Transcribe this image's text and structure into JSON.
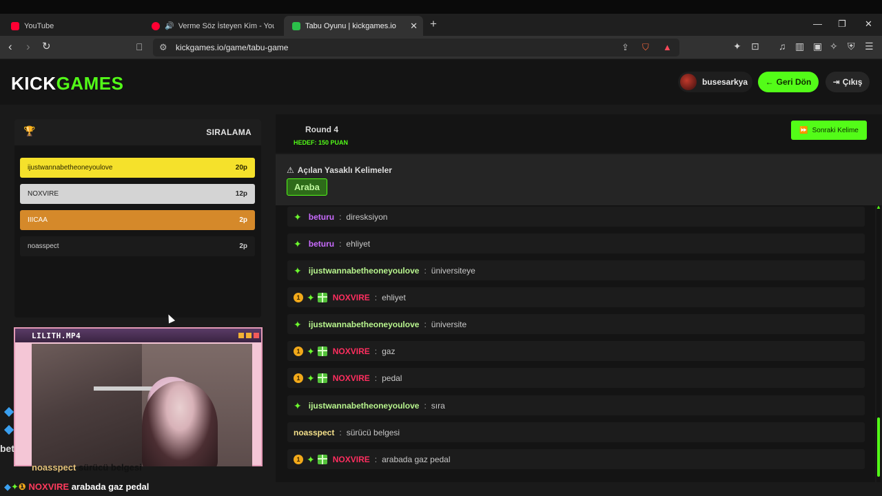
{
  "browser": {
    "tabs": [
      {
        "label": "YouTube",
        "icon": "youtube-icon"
      },
      {
        "label": "Verme Söz İsteyen Kim - YouTube",
        "icon": "youtube-icon"
      },
      {
        "label": "Tabu Oyunu | kickgames.io",
        "icon": "kick-icon"
      }
    ],
    "url": "kickgames.io/game/tabu-game"
  },
  "header": {
    "logo_a": "KICK",
    "logo_b": "GAMES",
    "username": "busesarkya",
    "back_label": "Geri Dön",
    "logout_label": "Çıkış"
  },
  "leaderboard": {
    "title": "SIRALAMA",
    "rows": [
      {
        "name": "ijustwannabetheoneyoulove",
        "score": "20p"
      },
      {
        "name": "NOXVIRE",
        "score": "12p"
      },
      {
        "name": "IIICAA",
        "score": "2p"
      },
      {
        "name": "noasspect",
        "score": "2p"
      }
    ]
  },
  "webcam": {
    "title": "LILITH.MP4"
  },
  "overlay": {
    "line1_user": "noasspect",
    "line1_text": "sürücü belgesi",
    "line2_user": "NOXVIRE",
    "line2_text": "arabada gaz pedal",
    "side_text": "bet"
  },
  "game": {
    "round": "Round 4",
    "target": "HEDEF: 150 PUAN",
    "next_label": "Sonraki Kelime",
    "forbidden_title": "Açılan Yasaklı Kelimeler",
    "forbidden_words": [
      "Araba"
    ]
  },
  "chat": [
    {
      "user": "beturu",
      "text": "diresksiyon"
    },
    {
      "user": "beturu",
      "text": "ehliyet"
    },
    {
      "user": "ijustwannabetheoneyoulove",
      "text": "üniversiteye"
    },
    {
      "user": "NOXVIRE",
      "text": "ehliyet"
    },
    {
      "user": "ijustwannabetheoneyoulove",
      "text": "üniversite"
    },
    {
      "user": "NOXVIRE",
      "text": "gaz"
    },
    {
      "user": "NOXVIRE",
      "text": "pedal"
    },
    {
      "user": "ijustwannabetheoneyoulove",
      "text": "sıra"
    },
    {
      "user": "noasspect",
      "text": "sürücü belgesi"
    },
    {
      "user": "NOXVIRE",
      "text": "arabada gaz pedal"
    }
  ],
  "badges": {
    "one": "1"
  },
  "colors": {
    "accent": "#53fc18",
    "gold": "#f5e12b",
    "silver": "#d4d4d4",
    "bronze": "#d5892a"
  }
}
